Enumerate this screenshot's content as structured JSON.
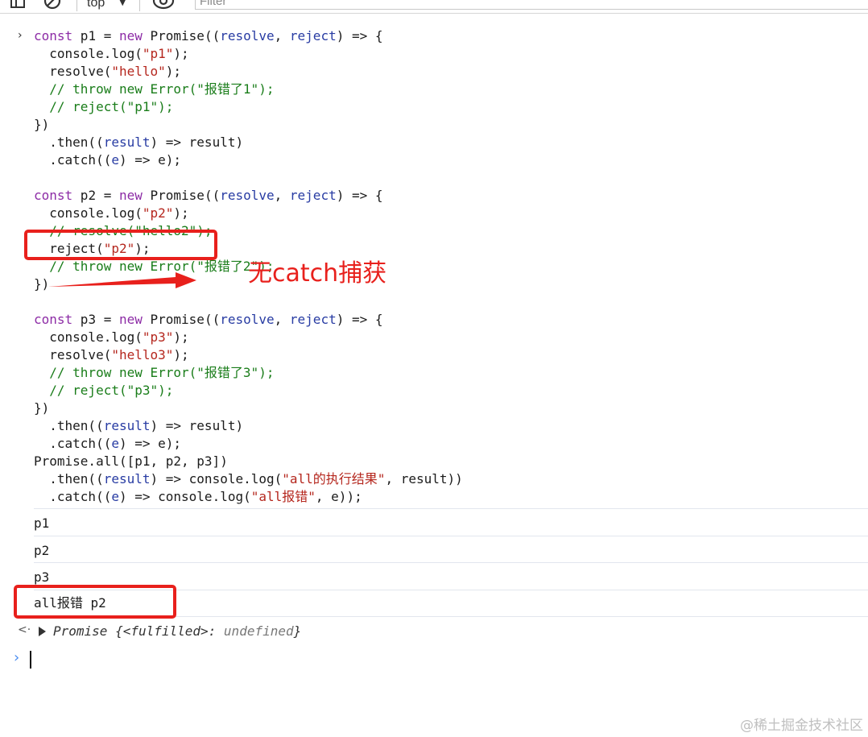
{
  "toolbar": {
    "context": "top",
    "filter_placeholder": "Filter",
    "icons": [
      "sidebar-toggle-icon",
      "clear-console-icon",
      "eye-icon"
    ]
  },
  "code_lines": [
    [
      [
        "kw",
        "const"
      ],
      [
        "t",
        " p1 = "
      ],
      [
        "kw",
        "new"
      ],
      [
        "t",
        " Promise(("
      ],
      [
        "pm",
        "resolve"
      ],
      [
        "t",
        ", "
      ],
      [
        "pm",
        "reject"
      ],
      [
        "t",
        ") => {"
      ]
    ],
    [
      [
        "t",
        "  console.log("
      ],
      [
        "str",
        "\"p1\""
      ],
      [
        "t",
        ");"
      ]
    ],
    [
      [
        "t",
        "  resolve("
      ],
      [
        "str",
        "\"hello\""
      ],
      [
        "t",
        ");"
      ]
    ],
    [
      [
        "cm",
        "  // throw new Error(\"报错了1\");"
      ]
    ],
    [
      [
        "cm",
        "  // reject(\"p1\");"
      ]
    ],
    [
      [
        "t",
        "})"
      ]
    ],
    [
      [
        "t",
        "  .then(("
      ],
      [
        "pm",
        "result"
      ],
      [
        "t",
        ") => result)"
      ]
    ],
    [
      [
        "t",
        "  .catch(("
      ],
      [
        "pm",
        "e"
      ],
      [
        "t",
        ") => e);"
      ]
    ],
    [
      [
        "t",
        ""
      ]
    ],
    [
      [
        "kw",
        "const"
      ],
      [
        "t",
        " p2 = "
      ],
      [
        "kw",
        "new"
      ],
      [
        "t",
        " Promise(("
      ],
      [
        "pm",
        "resolve"
      ],
      [
        "t",
        ", "
      ],
      [
        "pm",
        "reject"
      ],
      [
        "t",
        ") => {"
      ]
    ],
    [
      [
        "t",
        "  console.log("
      ],
      [
        "str",
        "\"p2\""
      ],
      [
        "t",
        ");"
      ]
    ],
    [
      [
        "cm",
        "  // resolve(\"hello2\");"
      ]
    ],
    [
      [
        "t",
        "  reject("
      ],
      [
        "str",
        "\"p2\""
      ],
      [
        "t",
        ");"
      ]
    ],
    [
      [
        "cm",
        "  // throw new Error(\"报错了2\");"
      ]
    ],
    [
      [
        "t",
        "})"
      ]
    ],
    [
      [
        "t",
        ""
      ]
    ],
    [
      [
        "kw",
        "const"
      ],
      [
        "t",
        " p3 = "
      ],
      [
        "kw",
        "new"
      ],
      [
        "t",
        " Promise(("
      ],
      [
        "pm",
        "resolve"
      ],
      [
        "t",
        ", "
      ],
      [
        "pm",
        "reject"
      ],
      [
        "t",
        ") => {"
      ]
    ],
    [
      [
        "t",
        "  console.log("
      ],
      [
        "str",
        "\"p3\""
      ],
      [
        "t",
        ");"
      ]
    ],
    [
      [
        "t",
        "  resolve("
      ],
      [
        "str",
        "\"hello3\""
      ],
      [
        "t",
        ");"
      ]
    ],
    [
      [
        "cm",
        "  // throw new Error(\"报错了3\");"
      ]
    ],
    [
      [
        "cm",
        "  // reject(\"p3\");"
      ]
    ],
    [
      [
        "t",
        "})"
      ]
    ],
    [
      [
        "t",
        "  .then(("
      ],
      [
        "pm",
        "result"
      ],
      [
        "t",
        ") => result)"
      ]
    ],
    [
      [
        "t",
        "  .catch(("
      ],
      [
        "pm",
        "e"
      ],
      [
        "t",
        ") => e);"
      ]
    ],
    [
      [
        "t",
        "Promise.all([p1, p2, p3])"
      ]
    ],
    [
      [
        "t",
        "  .then(("
      ],
      [
        "pm",
        "result"
      ],
      [
        "t",
        ") => console.log("
      ],
      [
        "str",
        "\"all的执行结果\""
      ],
      [
        "t",
        ", result))"
      ]
    ],
    [
      [
        "t",
        "  .catch(("
      ],
      [
        "pm",
        "e"
      ],
      [
        "t",
        ") => console.log("
      ],
      [
        "str",
        "\"all报错\""
      ],
      [
        "t",
        ", e));"
      ]
    ]
  ],
  "logs": [
    "p1",
    "p2",
    "p3",
    "all报错 p2"
  ],
  "result": {
    "prefix": "Promise ",
    "open": "{<fulfilled>: ",
    "value": "undefined",
    "close": "}"
  },
  "annotation": "无catch捕获",
  "watermark": "@稀土掘金技术社区",
  "colors": {
    "keyword": "#8d2ca6",
    "string": "#b5271e",
    "comment": "#1a7d1a",
    "param": "#283ca3",
    "highlight": "#e8201c"
  }
}
